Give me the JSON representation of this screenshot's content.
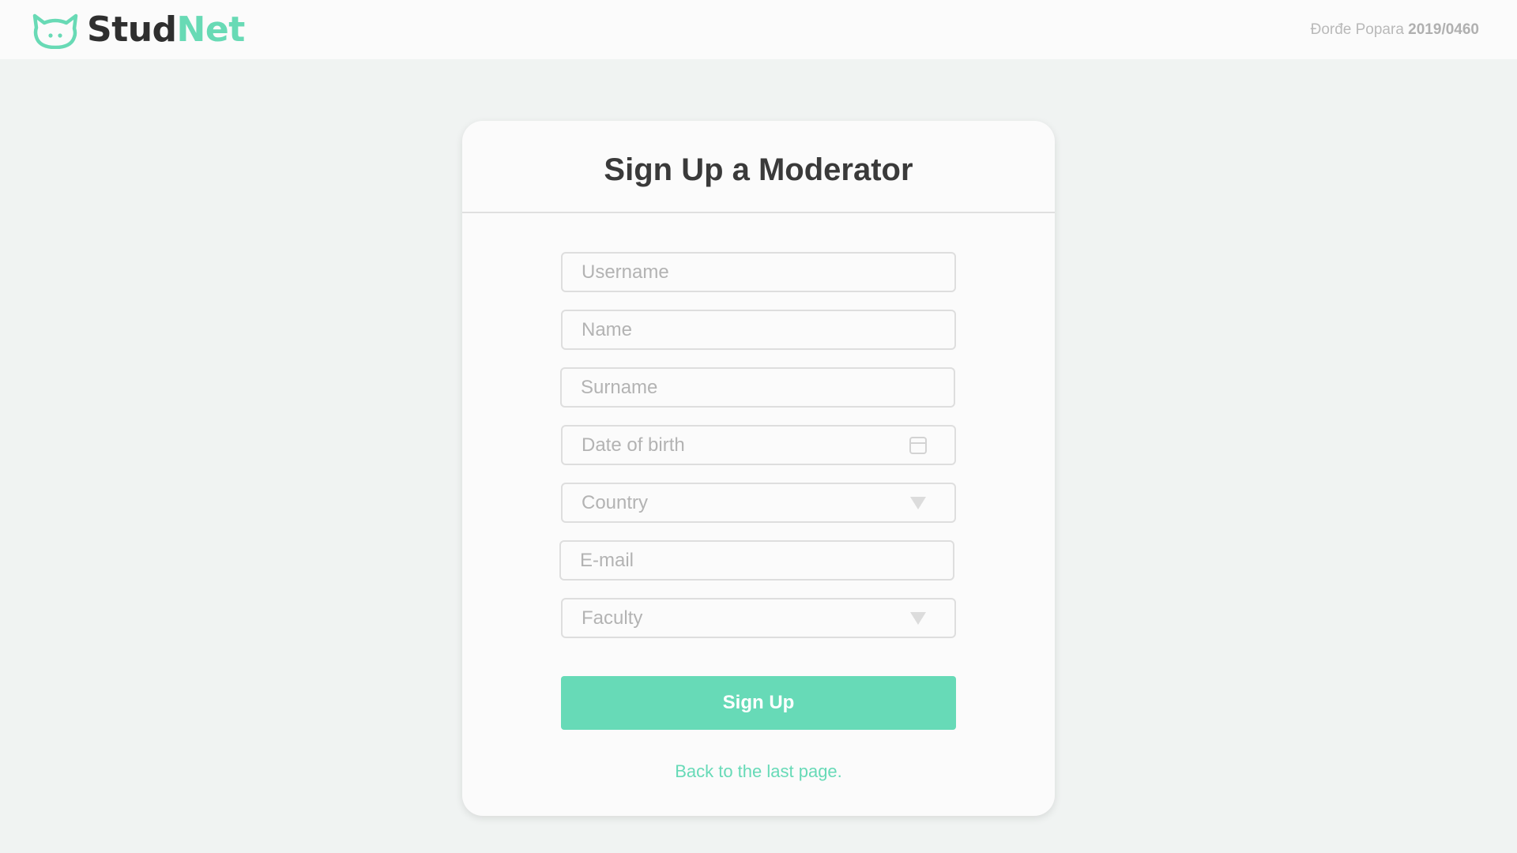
{
  "brand": {
    "name_part1": "Stud",
    "name_part2": "Net",
    "accent_color": "#68dab5",
    "logo_icon": "cat-face-icon"
  },
  "header": {
    "user_name": "Đorđe Popara",
    "user_id": "2019/0460"
  },
  "form": {
    "title": "Sign Up a Moderator",
    "fields": {
      "username": {
        "placeholder": "Username",
        "value": ""
      },
      "name": {
        "placeholder": "Name",
        "value": ""
      },
      "surname": {
        "placeholder": "Surname",
        "value": ""
      },
      "dob": {
        "placeholder": "Date of birth",
        "value": "",
        "icon": "calendar-icon"
      },
      "country": {
        "selected": "Country",
        "icon": "dropdown-arrow-icon"
      },
      "email": {
        "placeholder": "E-mail",
        "value": ""
      },
      "faculty": {
        "selected": "Faculty",
        "icon": "dropdown-arrow-icon"
      }
    },
    "submit_label": "Sign Up",
    "back_link": "Back to the last page.",
    "button_color": "#67dab7"
  }
}
